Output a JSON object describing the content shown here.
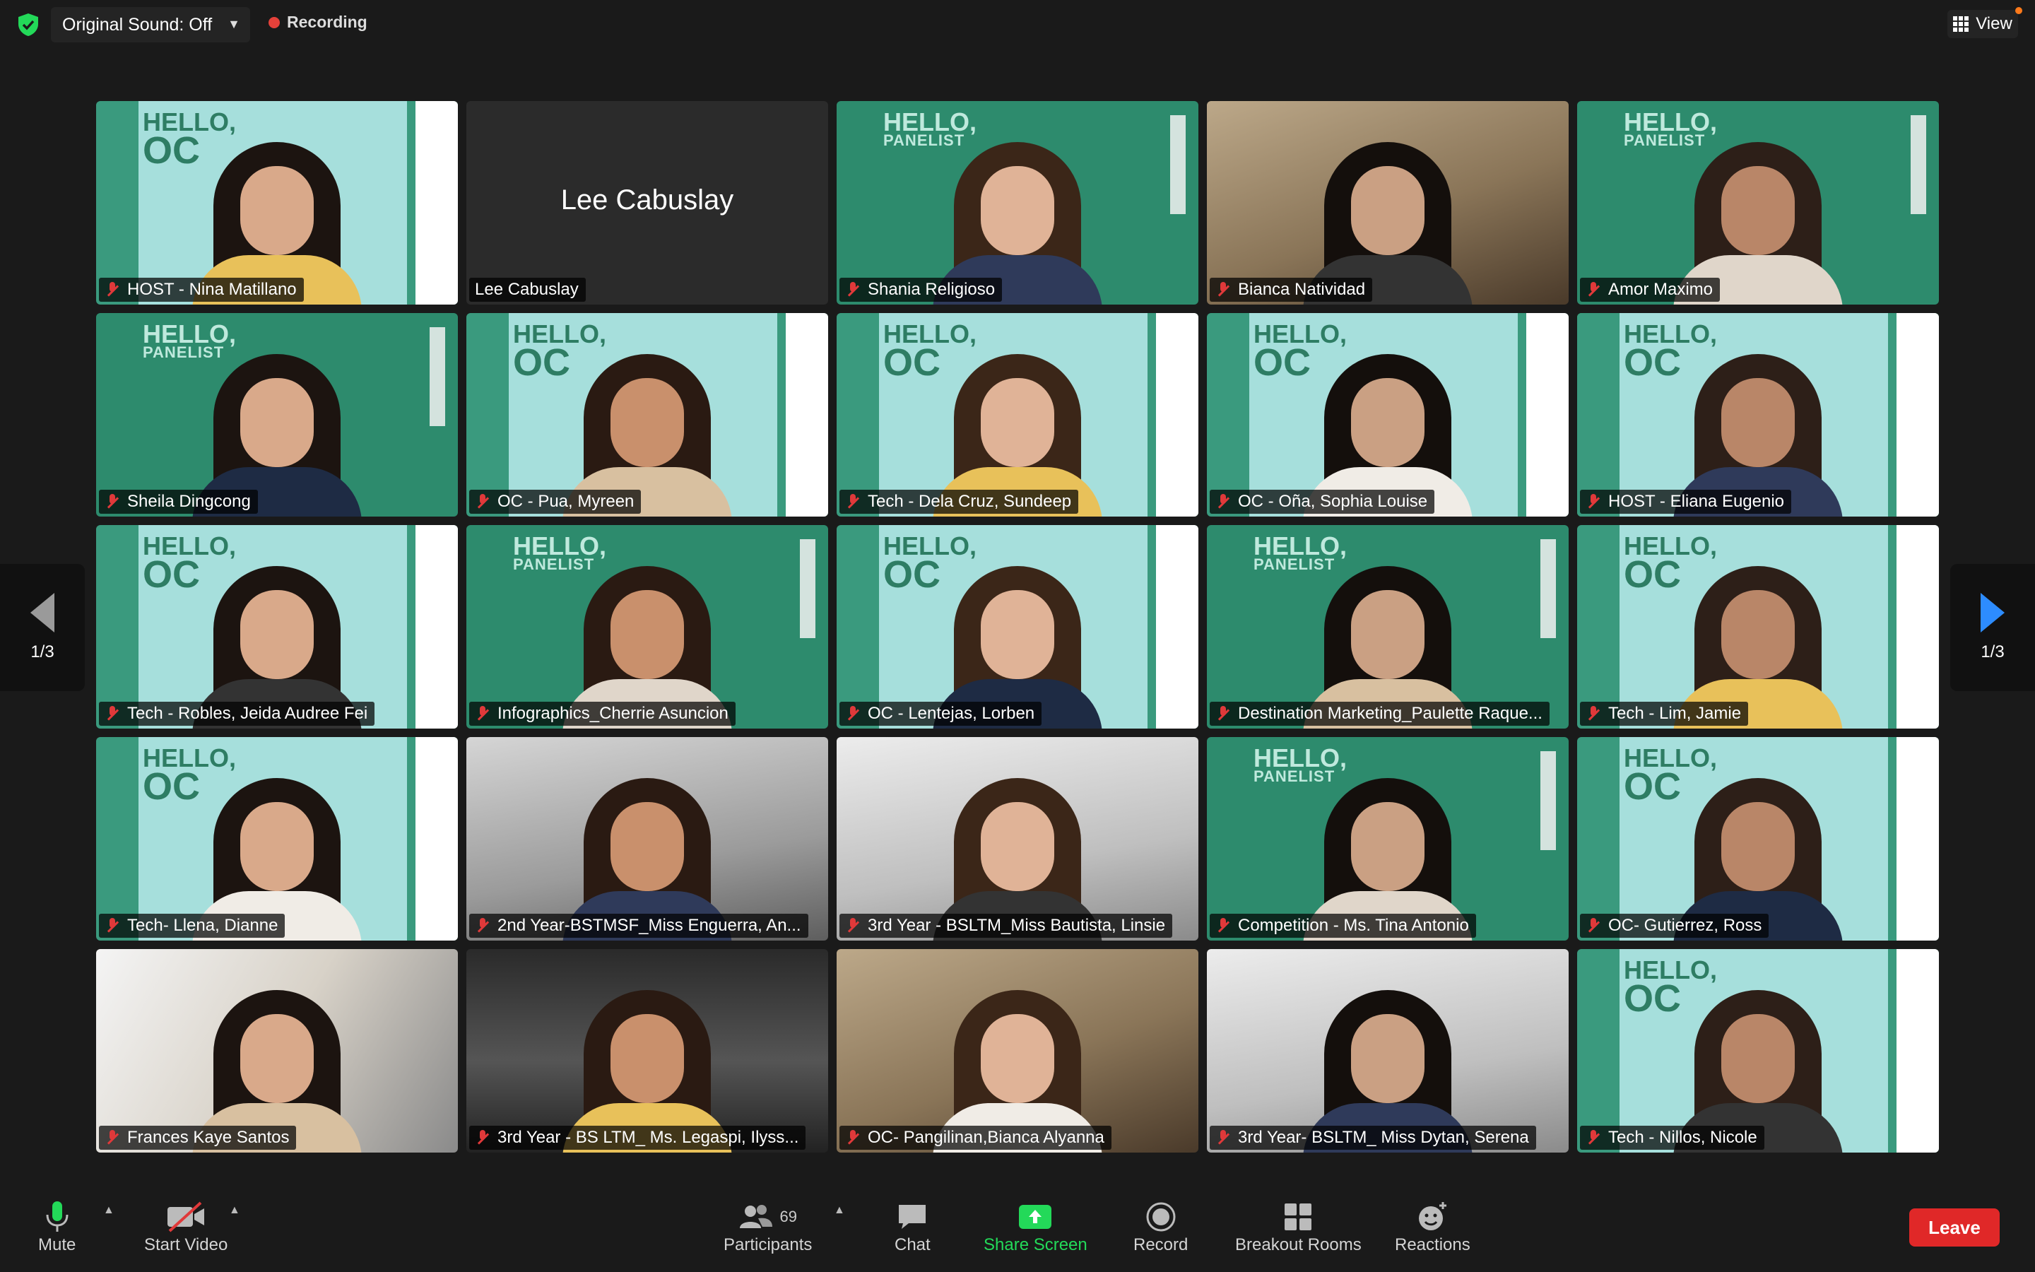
{
  "topbar": {
    "sound_label": "Original Sound: Off",
    "recording_label": "Recording",
    "view_label": "View"
  },
  "nav": {
    "left_page": "1/3",
    "right_page": "1/3"
  },
  "tiles": [
    {
      "name": "HOST - Nina Matillano",
      "muted": true,
      "bg": "green"
    },
    {
      "name": "Lee Cabuslay",
      "muted": false,
      "bg": "none",
      "big_name": "Lee Cabuslay"
    },
    {
      "name": "Shania Religioso",
      "muted": true,
      "bg": "panelist"
    },
    {
      "name": "Bianca Natividad",
      "muted": true,
      "bg": "room"
    },
    {
      "name": "Amor Maximo",
      "muted": true,
      "bg": "panelist"
    },
    {
      "name": "Sheila Dingcong",
      "muted": true,
      "bg": "panelist"
    },
    {
      "name": "OC - Pua, Myreen",
      "muted": true,
      "bg": "green"
    },
    {
      "name": "Tech - Dela Cruz, Sundeep",
      "muted": true,
      "bg": "green"
    },
    {
      "name": "OC - Oña, Sophia Louise",
      "muted": true,
      "bg": "green"
    },
    {
      "name": "HOST - Eliana Eugenio",
      "muted": true,
      "bg": "green",
      "active": true
    },
    {
      "name": "Tech - Robles, Jeida Audree Fei",
      "muted": true,
      "bg": "green"
    },
    {
      "name": "Infographics_Cherrie Asuncion",
      "muted": true,
      "bg": "panelist"
    },
    {
      "name": "OC - Lentejas, Lorben",
      "muted": true,
      "bg": "green"
    },
    {
      "name": "Destination Marketing_Paulette Raque...",
      "muted": true,
      "bg": "panelist"
    },
    {
      "name": "Tech - Lim, Jamie",
      "muted": true,
      "bg": "green"
    },
    {
      "name": "Tech- Llena, Dianne",
      "muted": true,
      "bg": "green"
    },
    {
      "name": "2nd Year-BSTMSF_Miss Enguerra, An...",
      "muted": true,
      "bg": "gray"
    },
    {
      "name": "3rd Year - BSLTM_Miss Bautista, Linsie",
      "muted": true,
      "bg": "light"
    },
    {
      "name": "Competition - Ms. Tina Antonio",
      "muted": true,
      "bg": "panelist"
    },
    {
      "name": "OC- Gutierrez, Ross",
      "muted": true,
      "bg": "green"
    },
    {
      "name": "Frances Kaye Santos",
      "muted": true,
      "bg": "window"
    },
    {
      "name": "3rd Year - BS LTM_ Ms. Legaspi, Ilyss...",
      "muted": true,
      "bg": "car"
    },
    {
      "name": "OC- Pangilinan,Bianca Alyanna",
      "muted": true,
      "bg": "room"
    },
    {
      "name": "3rd Year- BSLTM_ Miss Dytan, Serena",
      "muted": true,
      "bg": "light"
    },
    {
      "name": "Tech - Nillos, Nicole",
      "muted": true,
      "bg": "green"
    }
  ],
  "hello_text": {
    "hello": "HELLO,",
    "oc": "OC",
    "panelist": "PANELIST"
  },
  "toolbar": {
    "mute": "Mute",
    "start_video": "Start Video",
    "participants": "Participants",
    "participants_count": "69",
    "chat": "Chat",
    "share_screen": "Share Screen",
    "record": "Record",
    "breakout_rooms": "Breakout Rooms",
    "reactions": "Reactions",
    "leave": "Leave"
  },
  "colors": {
    "accent_green": "#23d959",
    "leave_red": "#e02828",
    "nav_blue": "#2d8cff",
    "background": "#1a1a1a"
  }
}
